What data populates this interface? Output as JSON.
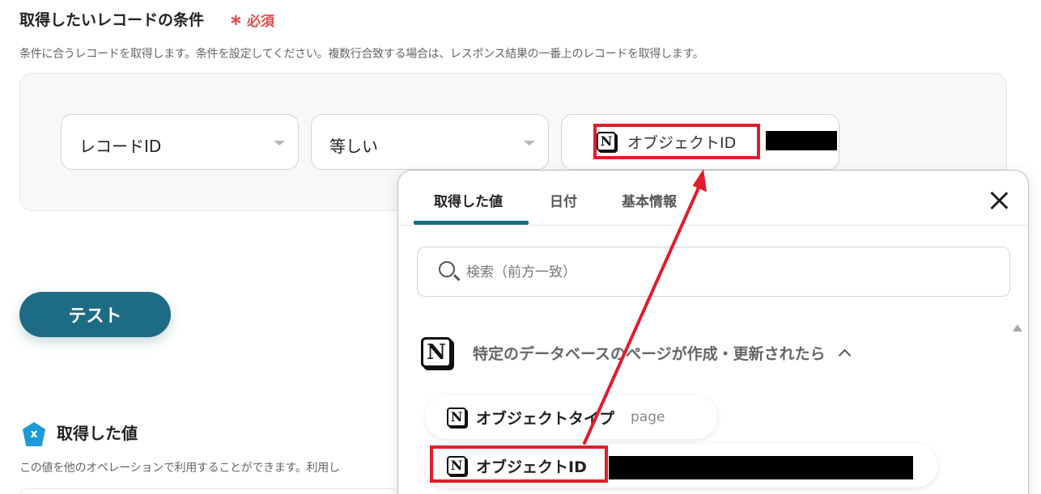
{
  "section": {
    "title": "取得したいレコードの条件",
    "required_star": "∗",
    "required_label": "必須",
    "description": "条件に合うレコードを取得します。条件を設定してください。複数行合致する場合は、レスポンス結果の一番上のレコードを取得します。"
  },
  "condition": {
    "field_value": "レコードID",
    "operator_value": "等しい",
    "value_chip_icon": "notion-icon",
    "value_chip_label": "オブジェクトID"
  },
  "test_button": {
    "label": "テスト"
  },
  "output": {
    "badge_icon": "x-pentagon-icon",
    "badge_glyph": "x",
    "title": "取得した値",
    "description": "この値を他のオペレーションで利用することができます。利用し"
  },
  "popup": {
    "tabs": [
      {
        "label": "取得した値",
        "active": true
      },
      {
        "label": "日付",
        "active": false
      },
      {
        "label": "基本情報",
        "active": false
      }
    ],
    "close_icon": "close-icon",
    "search_placeholder": "検索（前方一致）",
    "group": {
      "icon": "notion-icon",
      "label": "特定のデータベースのページが作成・更新されたら",
      "expanded": true
    },
    "items": [
      {
        "name": "オブジェクトタイプ",
        "value": "page"
      },
      {
        "name": "オブジェクトID",
        "value": ""
      }
    ]
  },
  "annotation": {
    "highlight_color": "#e11d2a",
    "arrow_color": "#e11d2a"
  },
  "colors": {
    "accent": "#1e6b85",
    "required": "#e44b4b",
    "badge": "#1b9bd8"
  }
}
